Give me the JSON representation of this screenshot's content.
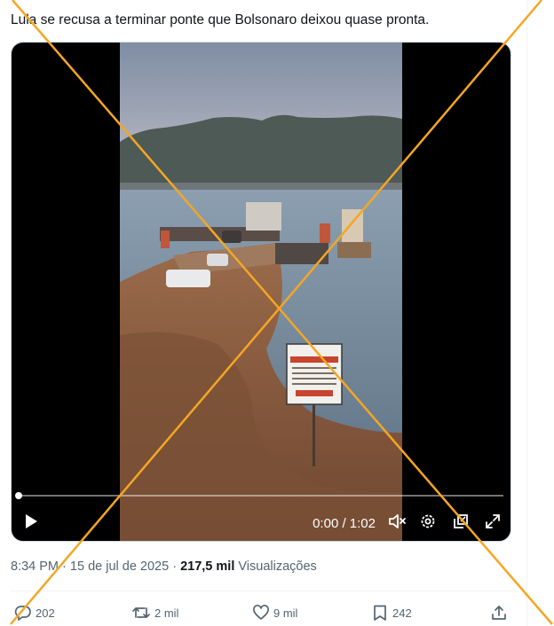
{
  "tweet": {
    "text": "Lula se recusa a terminar ponte que Bolsonaro deixou quase pronta.",
    "time": "8:34 PM",
    "date": "15 de jul de 2025",
    "separator": "·",
    "views_count": "217,5 mil",
    "views_label": "Visualizações"
  },
  "video": {
    "time_display": "0:00 / 1:02",
    "progress": 0.0,
    "sign_title": "ATENÇÃO",
    "sign_footer": "ÁREA DE RISCO"
  },
  "actions": {
    "replies": "202",
    "reposts": "2 mil",
    "likes": "9 mil",
    "bookmarks": "242"
  },
  "icons": {
    "play": "play-icon",
    "mute": "speaker-muted-icon",
    "settings": "gear-icon",
    "pip": "picture-in-picture-icon",
    "fullscreen": "expand-icon",
    "reply": "speech-bubble-icon",
    "repost": "repost-arrows-icon",
    "like": "heart-icon",
    "bookmark": "bookmark-icon",
    "share": "share-upload-icon"
  },
  "colors": {
    "accent_cross": "#f5a623",
    "muted_text": "#536471",
    "primary_text": "#0f1419"
  }
}
